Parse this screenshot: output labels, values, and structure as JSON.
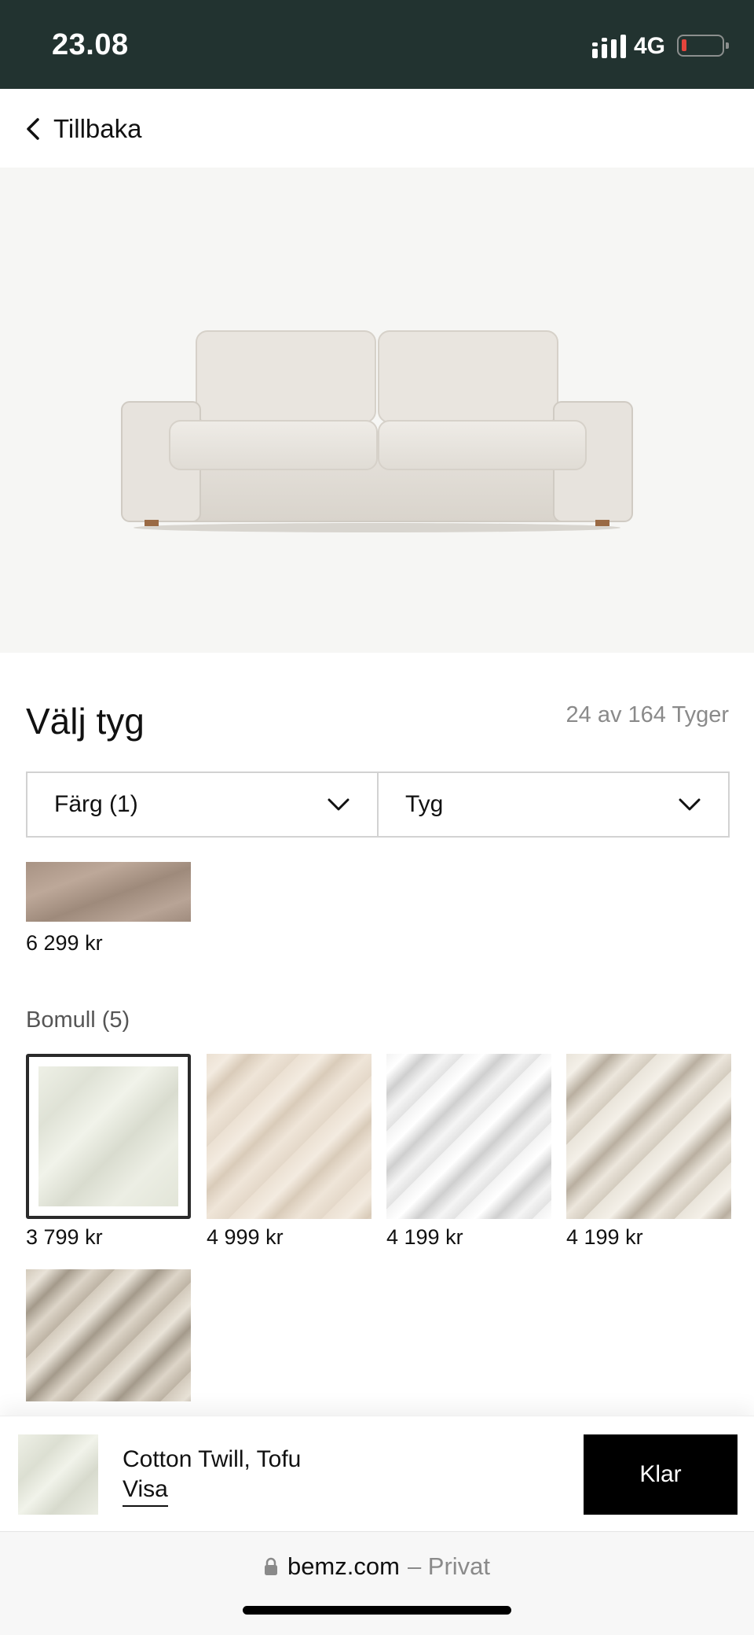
{
  "status_bar": {
    "time": "23.08",
    "network": "4G"
  },
  "nav": {
    "back_label": "Tillbaka"
  },
  "page": {
    "title": "Välj tyg",
    "count": "24 av 164 Tyger"
  },
  "filters": [
    {
      "label": "Färg (1)"
    },
    {
      "label": "Tyg"
    }
  ],
  "previous_item": {
    "price": "6 299 kr"
  },
  "group": {
    "title": "Bomull (5)",
    "items": [
      {
        "price": "3 799 kr",
        "selected": true
      },
      {
        "price": "4 999 kr",
        "selected": false
      },
      {
        "price": "4 199 kr",
        "selected": false
      },
      {
        "price": "4 199 kr",
        "selected": false
      },
      {
        "price": "",
        "selected": false
      }
    ]
  },
  "selection": {
    "name": "Cotton Twill, Tofu",
    "show_label": "Visa",
    "done_label": "Klar"
  },
  "browser": {
    "domain": "bemz.com",
    "mode": "– Privat"
  },
  "colors": {
    "status_bar": "#223330",
    "hero_bg": "#f6f6f4",
    "button_bg": "#000000"
  }
}
